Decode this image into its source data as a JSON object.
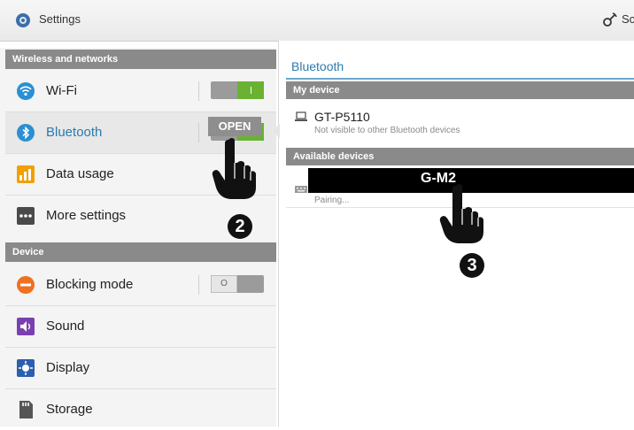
{
  "topbar": {
    "title": "Settings",
    "right_text": "Sc",
    "icons": {
      "app": "gear-icon",
      "right": "scan-icon"
    }
  },
  "sidebar": {
    "section_wireless": "Wireless and networks",
    "section_device": "Device",
    "items": [
      {
        "label": "Wi-Fi",
        "icon": "wifi-icon",
        "toggle": "on"
      },
      {
        "label": "Bluetooth",
        "icon": "bluetooth-icon",
        "toggle": "on"
      },
      {
        "label": "Data usage",
        "icon": "data-usage-icon"
      },
      {
        "label": "More settings",
        "icon": "more-settings-icon"
      },
      {
        "label": "Blocking mode",
        "icon": "blocking-mode-icon",
        "toggle": "off",
        "toggle_text": "O"
      },
      {
        "label": "Sound",
        "icon": "sound-icon"
      },
      {
        "label": "Display",
        "icon": "display-icon"
      },
      {
        "label": "Storage",
        "icon": "storage-icon"
      }
    ]
  },
  "callout": {
    "open_label": "OPEN"
  },
  "main": {
    "title": "Bluetooth",
    "my_device_header": "My device",
    "my_device": {
      "name": "GT-P5110",
      "status": "Not visible to other Bluetooth devices"
    },
    "available_header": "Available devices",
    "available_device": {
      "name": "G-M2",
      "status": "Pairing..."
    }
  },
  "annotations": {
    "step2": "2",
    "step3": "3"
  },
  "colors": {
    "accent_blue": "#2a7ab0",
    "toggle_on": "#6ab231",
    "header_gray": "#8a8a8a"
  }
}
